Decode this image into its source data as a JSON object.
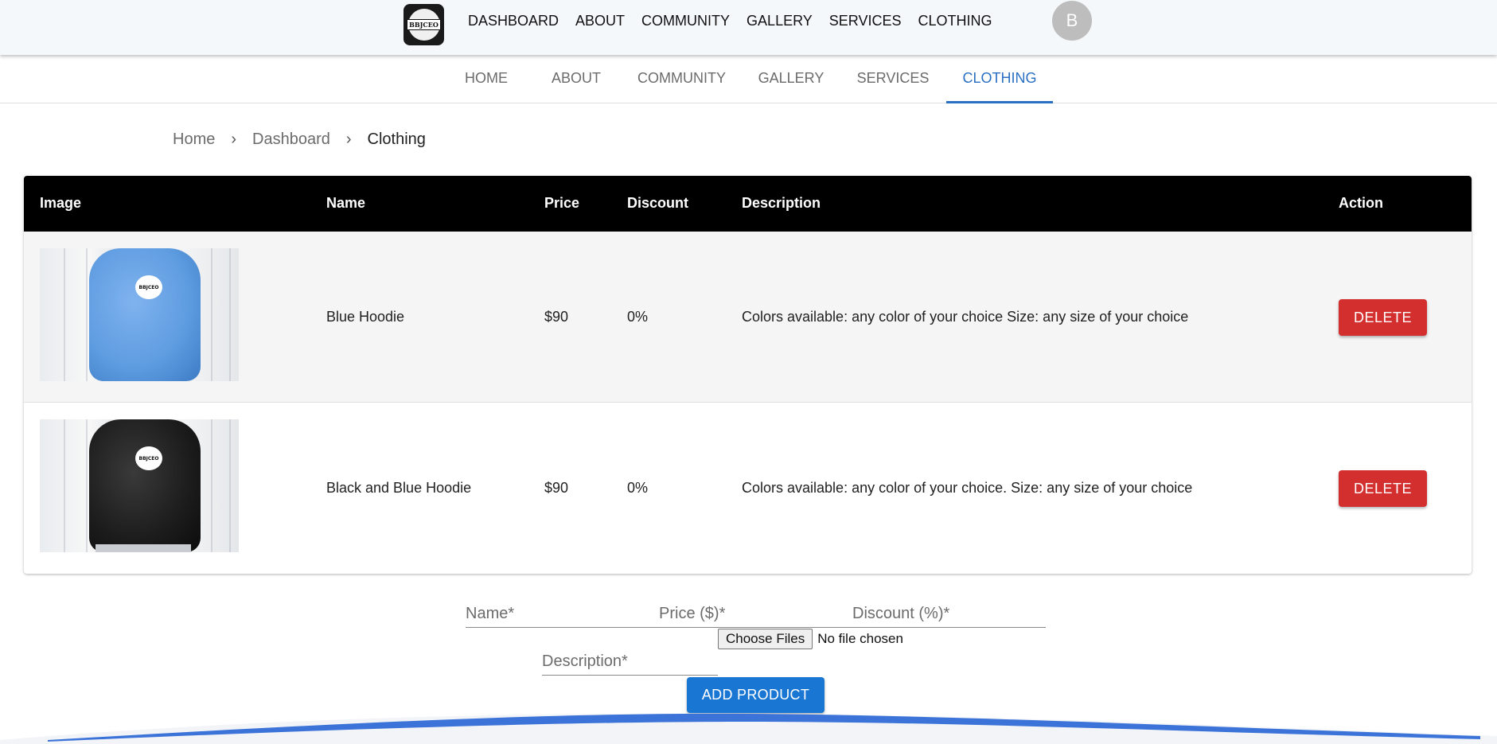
{
  "header": {
    "logo_text": "BBJCEO",
    "nav": [
      "DASHBOARD",
      "ABOUT",
      "COMMUNITY",
      "GALLERY",
      "SERVICES",
      "CLOTHING"
    ],
    "avatar_initial": "B"
  },
  "tabs": {
    "items": [
      "HOME",
      "ABOUT",
      "COMMUNITY",
      "GALLERY",
      "SERVICES",
      "CLOTHING"
    ],
    "active": "CLOTHING"
  },
  "breadcrumb": {
    "home": "Home",
    "dashboard": "Dashboard",
    "current": "Clothing"
  },
  "table": {
    "columns": [
      "Image",
      "Name",
      "Price",
      "Discount",
      "Description",
      "Action"
    ],
    "rows": [
      {
        "image_alt": "blue hoodie photo",
        "name": "Blue Hoodie",
        "price": "$90",
        "discount": "0%",
        "description": "Colors available: any color of your choice Size: any size of your choice",
        "action": "DELETE"
      },
      {
        "image_alt": "black hoodie photo",
        "name": "Black and Blue Hoodie",
        "price": "$90",
        "discount": "0%",
        "description": "Colors available: any color of your choice. Size: any size of your choice",
        "action": "DELETE"
      }
    ]
  },
  "form": {
    "name_placeholder": "Name*",
    "price_placeholder": "Price ($)*",
    "discount_placeholder": "Discount (%)*",
    "file_button": "Choose Files",
    "file_status": "No file chosen",
    "description_placeholder": "Description*",
    "submit_label": "ADD PRODUCT"
  },
  "colors": {
    "accent": "#2a6fc2",
    "delete": "#d32f2f",
    "primary_button": "#1976d2",
    "table_header": "#000000",
    "wave": "#3b73d9"
  }
}
